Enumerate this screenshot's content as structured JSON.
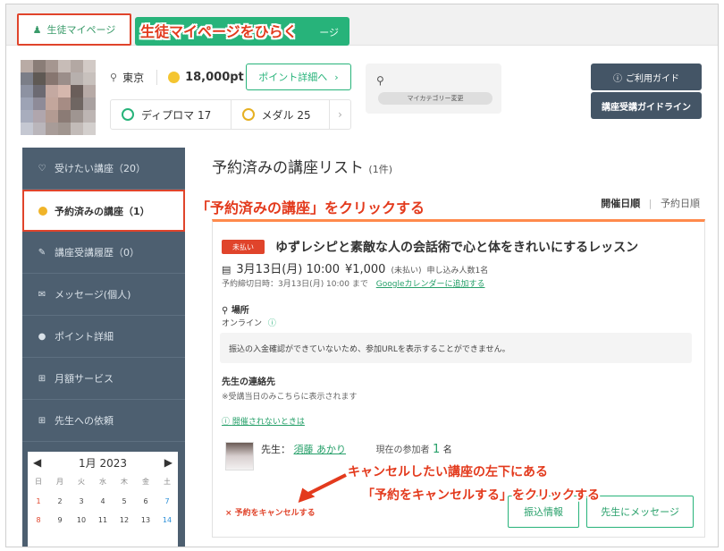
{
  "tabs": {
    "mypage_label": "生徒マイページ",
    "second_tail": "ージ"
  },
  "annotations": {
    "open_mypage": "生徒マイページをひらく",
    "click_reserved": "「予約済みの講座」をクリックする",
    "cancel_line1": "キャンセルしたい講座の左下にある",
    "cancel_line2": "「予約をキャンセルする」をクリックする"
  },
  "profile": {
    "location": "東京",
    "points": "18,000pt",
    "point_detail_button": "ポイント詳細へ",
    "diploma": "ディプロマ 17",
    "medal": "メダル 25",
    "category_change": "マイカテゴリー変更"
  },
  "header_buttons": {
    "guide": "ご利用ガイド",
    "guideline": "講座受講ガイドライン"
  },
  "sidebar": {
    "items": [
      {
        "icon": "heart-icon",
        "label": "受けたい講座（20）"
      },
      {
        "icon": "check-circle-icon",
        "label": "予約済みの講座（1）"
      },
      {
        "icon": "pencil-icon",
        "label": "講座受講履歴（0）"
      },
      {
        "icon": "mail-icon",
        "label": "メッセージ(個人)"
      },
      {
        "icon": "coin-icon",
        "label": "ポイント詳細"
      },
      {
        "icon": "grid-icon",
        "label": "月額サービス"
      },
      {
        "icon": "grid-icon",
        "label": "先生への依頼"
      }
    ]
  },
  "calendar": {
    "month": "1月 2023",
    "weekdays": [
      "日",
      "月",
      "火",
      "水",
      "木",
      "金",
      "土"
    ],
    "week1": [
      "1",
      "2",
      "3",
      "4",
      "5",
      "6",
      "7"
    ],
    "week2": [
      "8",
      "9",
      "10",
      "11",
      "12",
      "13",
      "14"
    ]
  },
  "main": {
    "title": "予約済みの講座リスト",
    "count": "(1件)",
    "sort_active": "開催日順",
    "sort_sep": "|",
    "sort_other": "予約日順"
  },
  "course": {
    "badge": "未払い",
    "title": "ゆずレシピと素敵な人の会話術で心と体をきれいにするレッスン",
    "date": "3月13日(月) 10:00",
    "price": "¥1,000",
    "unpaid_note": "(未払い)",
    "applicants": "申し込み人数1名",
    "deadline": "予約締切日時：3月13日(月) 10:00 まで",
    "calendar_link": "Googleカレンダーに追加する",
    "place_label": "場所",
    "place_value": "オンライン",
    "notice": "振込の入金確認ができていないため、参加URLを表示することができません。",
    "contact_label": "先生の連絡先",
    "contact_note": "※受講当日のみこちらに表示されます",
    "not_held_link": "開催されないときは",
    "teacher_prefix": "先生：",
    "teacher_name": "須藤 あかり",
    "participants_label": "現在の参加者",
    "participants_count": "1",
    "participants_unit": "名",
    "cancel_link": "× 予約をキャンセルする",
    "transfer_button": "振込情報",
    "message_button": "先生にメッセージ"
  },
  "colors": {
    "brand_green": "#27b37a",
    "alert_red": "#e0442b",
    "sidebar_bg": "#4d5f70",
    "dark_button": "#445566"
  }
}
